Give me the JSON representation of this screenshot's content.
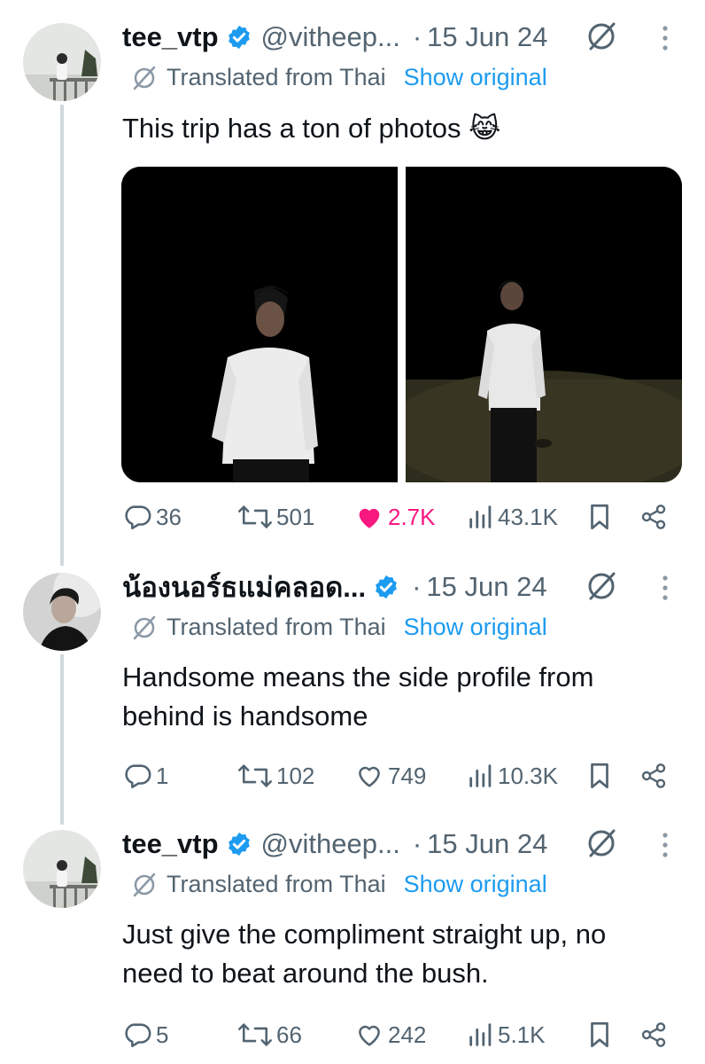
{
  "colors": {
    "accent": "#1d9bf0",
    "like": "#f91880",
    "muted": "#536471",
    "text": "#0f1419",
    "thread": "#cfd9de"
  },
  "tweets": [
    {
      "name": "tee_vtp",
      "handle": "@vitheep...",
      "dot": "·",
      "date": "15 Jun 24",
      "translated": "Translated from Thai",
      "show_original": "Show original",
      "text": "This trip has a ton of photos 😹",
      "replies": "36",
      "reposts": "501",
      "likes": "2.7K",
      "liked": true,
      "views": "43.1K"
    },
    {
      "name": "น้องนอร์ธแม่คลอด...",
      "handle": "",
      "dot": "·",
      "date": "15 Jun 24",
      "translated": "Translated from Thai",
      "show_original": "Show original",
      "text": "Handsome means the side profile from behind is handsome",
      "replies": "1",
      "reposts": "102",
      "likes": "749",
      "liked": false,
      "views": "10.3K"
    },
    {
      "name": "tee_vtp",
      "handle": "@vitheep...",
      "dot": "·",
      "date": "15 Jun 24",
      "translated": "Translated from Thai",
      "show_original": "Show original",
      "text": "Just give the compliment straight up, no need to beat around the bush.",
      "replies": "5",
      "reposts": "66",
      "likes": "242",
      "liked": false,
      "views": "5.1K"
    }
  ],
  "icons": [
    "verified-badge-icon",
    "grok-icon",
    "more-icon",
    "translate-icon",
    "reply-icon",
    "repost-icon",
    "like-icon",
    "views-icon",
    "bookmark-icon",
    "share-icon"
  ]
}
